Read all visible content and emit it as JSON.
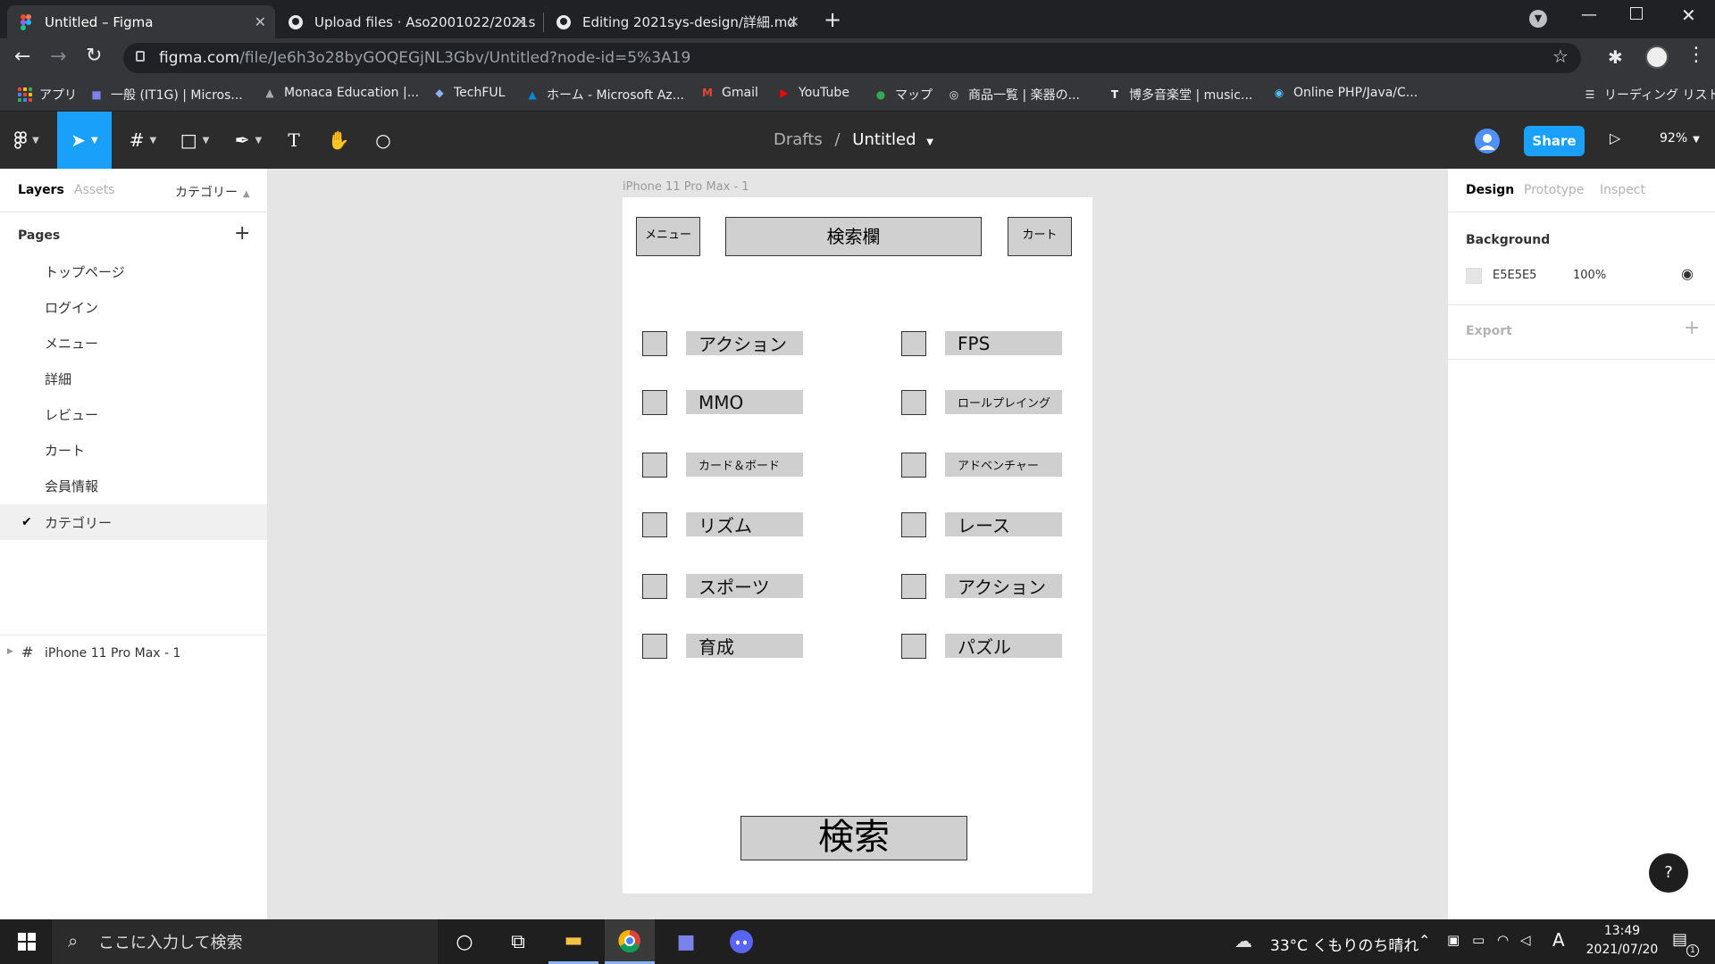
{
  "browser": {
    "tabs": [
      {
        "title": "Untitled – Figma",
        "favicon": "figma-logo",
        "active": true
      },
      {
        "title": "Upload files · Aso2001022/2021s",
        "favicon": "github-icon",
        "active": false
      },
      {
        "title": "Editing 2021sys-design/詳細.md",
        "favicon": "github-icon",
        "active": false
      }
    ],
    "url_host": "figma.com",
    "url_path": "/file/Je6h3o28byGOQEGjNL3Gbv/Untitled?node-id=5%3A19",
    "bookmarks": [
      "アプリ",
      "一般 (IT1G) | Micros...",
      "Monaca Education |...",
      "TechFUL",
      "ホーム - Microsoft Az...",
      "Gmail",
      "YouTube",
      "マップ",
      "商品一覧 | 楽器の...",
      "博多音楽堂 | music...",
      "Online PHP/Java/C..."
    ],
    "reading_list": "リーディング リスト"
  },
  "figma": {
    "breadcrumb_root": "Drafts",
    "breadcrumb_sep": "/",
    "file_name": "Untitled",
    "share_label": "Share",
    "zoom": "92%",
    "left_tabs": {
      "layers": "Layers",
      "assets": "Assets",
      "current_page": "カテゴリー"
    },
    "pages_heading": "Pages",
    "pages": [
      "トップページ",
      "ログイン",
      "メニュー",
      "詳細",
      "レビュー",
      "カート",
      "会員情報",
      "カテゴリー"
    ],
    "selected_page": "カテゴリー",
    "layer_frame": "iPhone 11 Pro Max - 1",
    "right_tabs": {
      "design": "Design",
      "prototype": "Prototype",
      "inspect": "Inspect"
    },
    "background_heading": "Background",
    "background_hex": "E5E5E5",
    "background_opacity": "100%",
    "export_heading": "Export",
    "help": "?"
  },
  "canvas": {
    "frame_label": "iPhone 11 Pro Max - 1",
    "menu_btn": "メニュー",
    "search_field": "検索欄",
    "cart_btn": "カート",
    "left_categories": [
      "アクション",
      "MMO",
      "カード＆ボード",
      "リズム",
      "スポーツ",
      "育成"
    ],
    "right_categories": [
      "FPS",
      "ロールプレイング",
      "アドベンチャー",
      "レース",
      "アクション",
      "パズル"
    ],
    "search_btn": "検索"
  },
  "taskbar": {
    "search_placeholder": "ここに入力して検索",
    "weather": "33°C くもりのち晴れ",
    "ime": "A",
    "time": "13:49",
    "date": "2021/07/20",
    "notification_count": "1"
  },
  "colors": {
    "figma_blue": "#18a0fb",
    "toolbar": "#2c2c2c",
    "canvas_bg": "#e5e5e5"
  }
}
